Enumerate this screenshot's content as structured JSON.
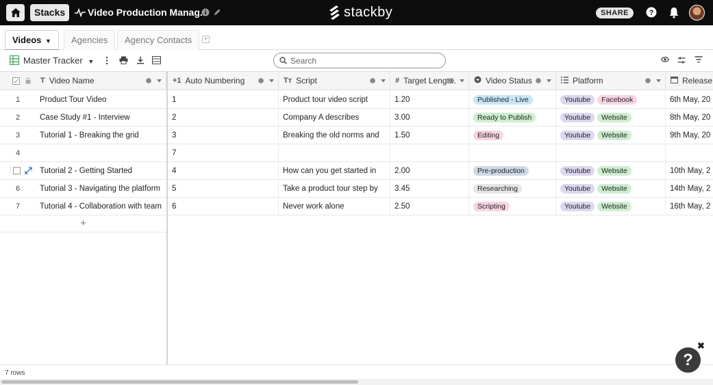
{
  "topbar": {
    "stacks_label": "Stacks",
    "stack_title": "Video Production Manag...",
    "brand": "stackby",
    "share_label": "SHARE"
  },
  "tabs": [
    {
      "label": "Videos",
      "active": true
    },
    {
      "label": "Agencies",
      "active": false
    },
    {
      "label": "Agency Contacts",
      "active": false
    }
  ],
  "toolbar": {
    "view_name": "Master Tracker",
    "search_placeholder": "Search"
  },
  "columns": [
    {
      "label": "Video Name",
      "icon": "T"
    },
    {
      "label": "Auto Numbering",
      "icon": "+1"
    },
    {
      "label": "Script",
      "icon": "Tт"
    },
    {
      "label": "Target Lengt...",
      "icon": "#"
    },
    {
      "label": "Video Status",
      "icon": "status"
    },
    {
      "label": "Platform",
      "icon": "list"
    },
    {
      "label": "Release",
      "icon": "calendar"
    }
  ],
  "rows": [
    {
      "num": "1",
      "name": "Product Tour Video",
      "auto": "1",
      "script": "Product tour video script",
      "length": "1.20",
      "status": "Published - Live",
      "status_color": "#c8e6f7",
      "platforms": [
        "Youtube",
        "Facebook"
      ],
      "release": "6th May, 20"
    },
    {
      "num": "2",
      "name": "Case Study #1 - Interview",
      "auto": "2",
      "script": "Company A describes",
      "length": "3.00",
      "status": "Ready to Publish",
      "status_color": "#cdeecf",
      "platforms": [
        "Youtube",
        "Website"
      ],
      "release": "8th May, 20"
    },
    {
      "num": "3",
      "name": "Tutorial 1 - Breaking the grid",
      "auto": "3",
      "script": "Breaking the old norms and",
      "length": "1.50",
      "status": "Editing",
      "status_color": "#f9d3e3",
      "platforms": [
        "Youtube",
        "Website"
      ],
      "release": "9th May, 20"
    },
    {
      "num": "4",
      "name": "",
      "auto": "7",
      "script": "",
      "length": "",
      "status": "",
      "status_color": "",
      "platforms": [],
      "release": ""
    },
    {
      "num": "",
      "name": "Tutorial 2 - Getting Started",
      "auto": "4",
      "script": "How can you get started in",
      "length": "2.00",
      "status": "Pre-production",
      "status_color": "#cfd8e6",
      "platforms": [
        "Youtube",
        "Website"
      ],
      "release": "10th May, 2"
    },
    {
      "num": "6",
      "name": "Tutorial 3 - Navigating the platform",
      "auto": "5",
      "script": "Take a product tour step by",
      "length": "3.45",
      "status": "Researching",
      "status_color": "#e6e6e6",
      "platforms": [
        "Youtube",
        "Website"
      ],
      "release": "14th May, 2"
    },
    {
      "num": "7",
      "name": "Tutorial 4 - Collaboration with team",
      "auto": "6",
      "script": "Never work alone",
      "length": "2.50",
      "status": "Scripting",
      "status_color": "#f9d3e3",
      "platforms": [
        "Youtube",
        "Website"
      ],
      "release": "16th May, 2"
    }
  ],
  "platform_colors": {
    "Youtube": "#dcd6ef",
    "Facebook": "#f9d3e3",
    "Website": "#cdeecf"
  },
  "footer": {
    "rows_count": "7 rows"
  },
  "icons": [
    "home-icon",
    "pulse-icon",
    "info-icon",
    "pencil-icon",
    "stackby-logo-icon",
    "help-icon",
    "bell-icon",
    "grid-view-icon",
    "caret-down-icon",
    "more-icon",
    "print-icon",
    "download-icon",
    "row-height-icon",
    "search-icon",
    "hide-fields-icon",
    "adjust-icon",
    "filter-icon",
    "checkbox-icon",
    "lock-icon",
    "expand-icon",
    "plus-icon",
    "close-icon"
  ]
}
